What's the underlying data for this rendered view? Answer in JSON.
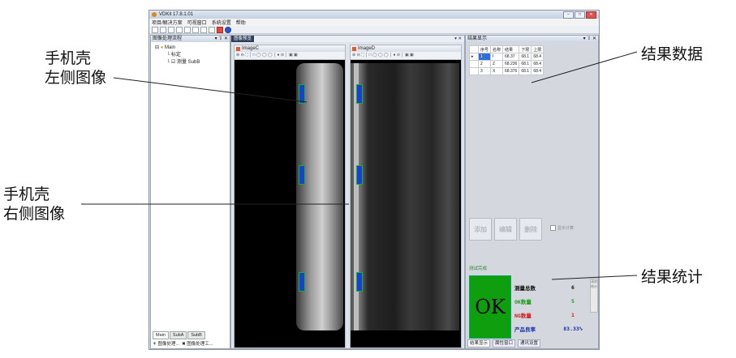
{
  "callouts": {
    "left_phone": [
      "手机壳",
      "左侧图像"
    ],
    "right_phone": [
      "手机壳",
      "右侧图像"
    ],
    "result_data": "结果数据",
    "result_stats": "结果统计"
  },
  "window": {
    "title": "VDKit  17.8.1.01",
    "menu": [
      "项目/解决方案",
      "可视窗口",
      "系统设置",
      "帮助"
    ]
  },
  "left_panel": {
    "header": "图像处理流程",
    "header_controls": "▾ ⇧ ✕",
    "tree_root": "Main",
    "tree_children": [
      "标定",
      "测量 SubB"
    ],
    "tabs": [
      "Main",
      "SubA",
      "SubB"
    ],
    "bottom_tabs": [
      "图像处理...",
      "图像处理工..."
    ]
  },
  "mid_panel": {
    "doc_tab": "图像预览",
    "doc_controls": "▾ ✕",
    "image_left_title": "ImageC",
    "image_right_title": "ImageD",
    "tool_glyphs": "⊕ ⊖ ⛶ │ □ ◯ ◯ ◯ │ ● ⊘ │ ▣ ▣"
  },
  "right_panel": {
    "header": "结果显示",
    "header_controls": "▾ ⇧ ✕",
    "table_headers": [
      "序号",
      "名称",
      "结果",
      "下限",
      "上限"
    ],
    "table_rows": [
      [
        "1",
        "I",
        "68.37",
        "68.1",
        "68.4"
      ],
      [
        "2",
        "Z",
        "68.236",
        "68.1",
        "68.4"
      ],
      [
        "3",
        "X",
        "68.376",
        "68.1",
        "68.4"
      ]
    ],
    "buttons": [
      "添加",
      "编辑",
      "删除"
    ],
    "checkbox_label": "显示计算",
    "test_done_label": "测试完成",
    "ok_text": "OK",
    "stats": [
      {
        "label": "测量总数",
        "value": "6",
        "color": "#111111"
      },
      {
        "label": "OK数量",
        "value": "5",
        "color": "#1e9a1e"
      },
      {
        "label": "NG数量",
        "value": "1",
        "color": "#d21a1a"
      },
      {
        "label": "产品良率",
        "value": "83.33%",
        "color": "#1a2fa8"
      }
    ],
    "side_strip": "清除统计",
    "bottom_tabs": [
      "结果显示",
      "属性窗口",
      "通讯设置"
    ]
  }
}
